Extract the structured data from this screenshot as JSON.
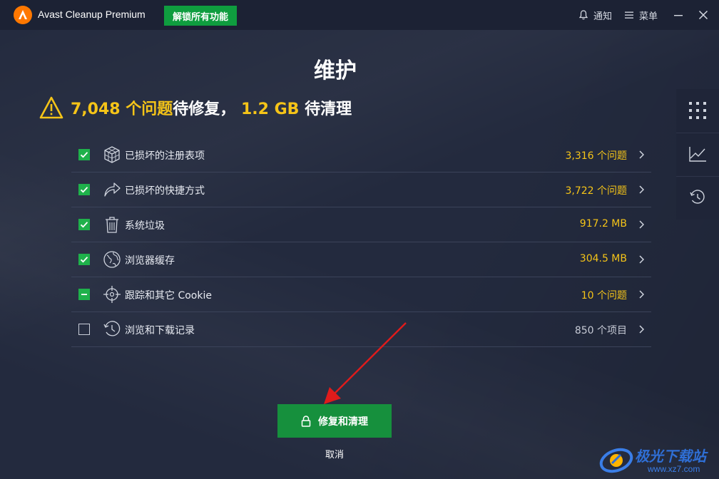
{
  "app": {
    "title": "Avast Cleanup Premium",
    "unlock_label": "解锁所有功能",
    "notify_label": "通知",
    "menu_label": "菜单"
  },
  "page": {
    "title": "维护",
    "summary": {
      "issues_count": "7,048 个问题",
      "issues_suffix": "待修复，",
      "size": "1.2 GB",
      "size_suffix": "待清理"
    }
  },
  "items": [
    {
      "label": "已损坏的注册表项",
      "value": "3,316 个问题",
      "state": "checked",
      "icon": "registry-cube-icon"
    },
    {
      "label": "已损坏的快捷方式",
      "value": "3,722 个问题",
      "state": "checked",
      "icon": "shortcut-arrow-icon"
    },
    {
      "label": "系统垃圾",
      "value": "917.2 MB",
      "state": "checked",
      "icon": "trash-icon"
    },
    {
      "label": "浏览器缓存",
      "value": "304.5 MB",
      "state": "checked",
      "icon": "globe-icon"
    },
    {
      "label": "跟踪和其它 Cookie",
      "value": "10 个问题",
      "state": "partial",
      "icon": "crosshair-icon"
    },
    {
      "label": "浏览和下载记录",
      "value": "850 个项目",
      "state": "unchecked",
      "icon": "history-clock-icon"
    }
  ],
  "actions": {
    "primary_label": "修复和清理",
    "cancel_label": "取消"
  },
  "side_panel": [
    "grid-icon",
    "chart-icon",
    "history-icon"
  ],
  "watermark": {
    "text": "极光下载站",
    "url": "www.xz7.com"
  },
  "colors": {
    "accent_green": "#16903d",
    "highlight_yellow": "#f5c418",
    "background": "#232a3e",
    "arrow_red": "#e01b1b"
  }
}
